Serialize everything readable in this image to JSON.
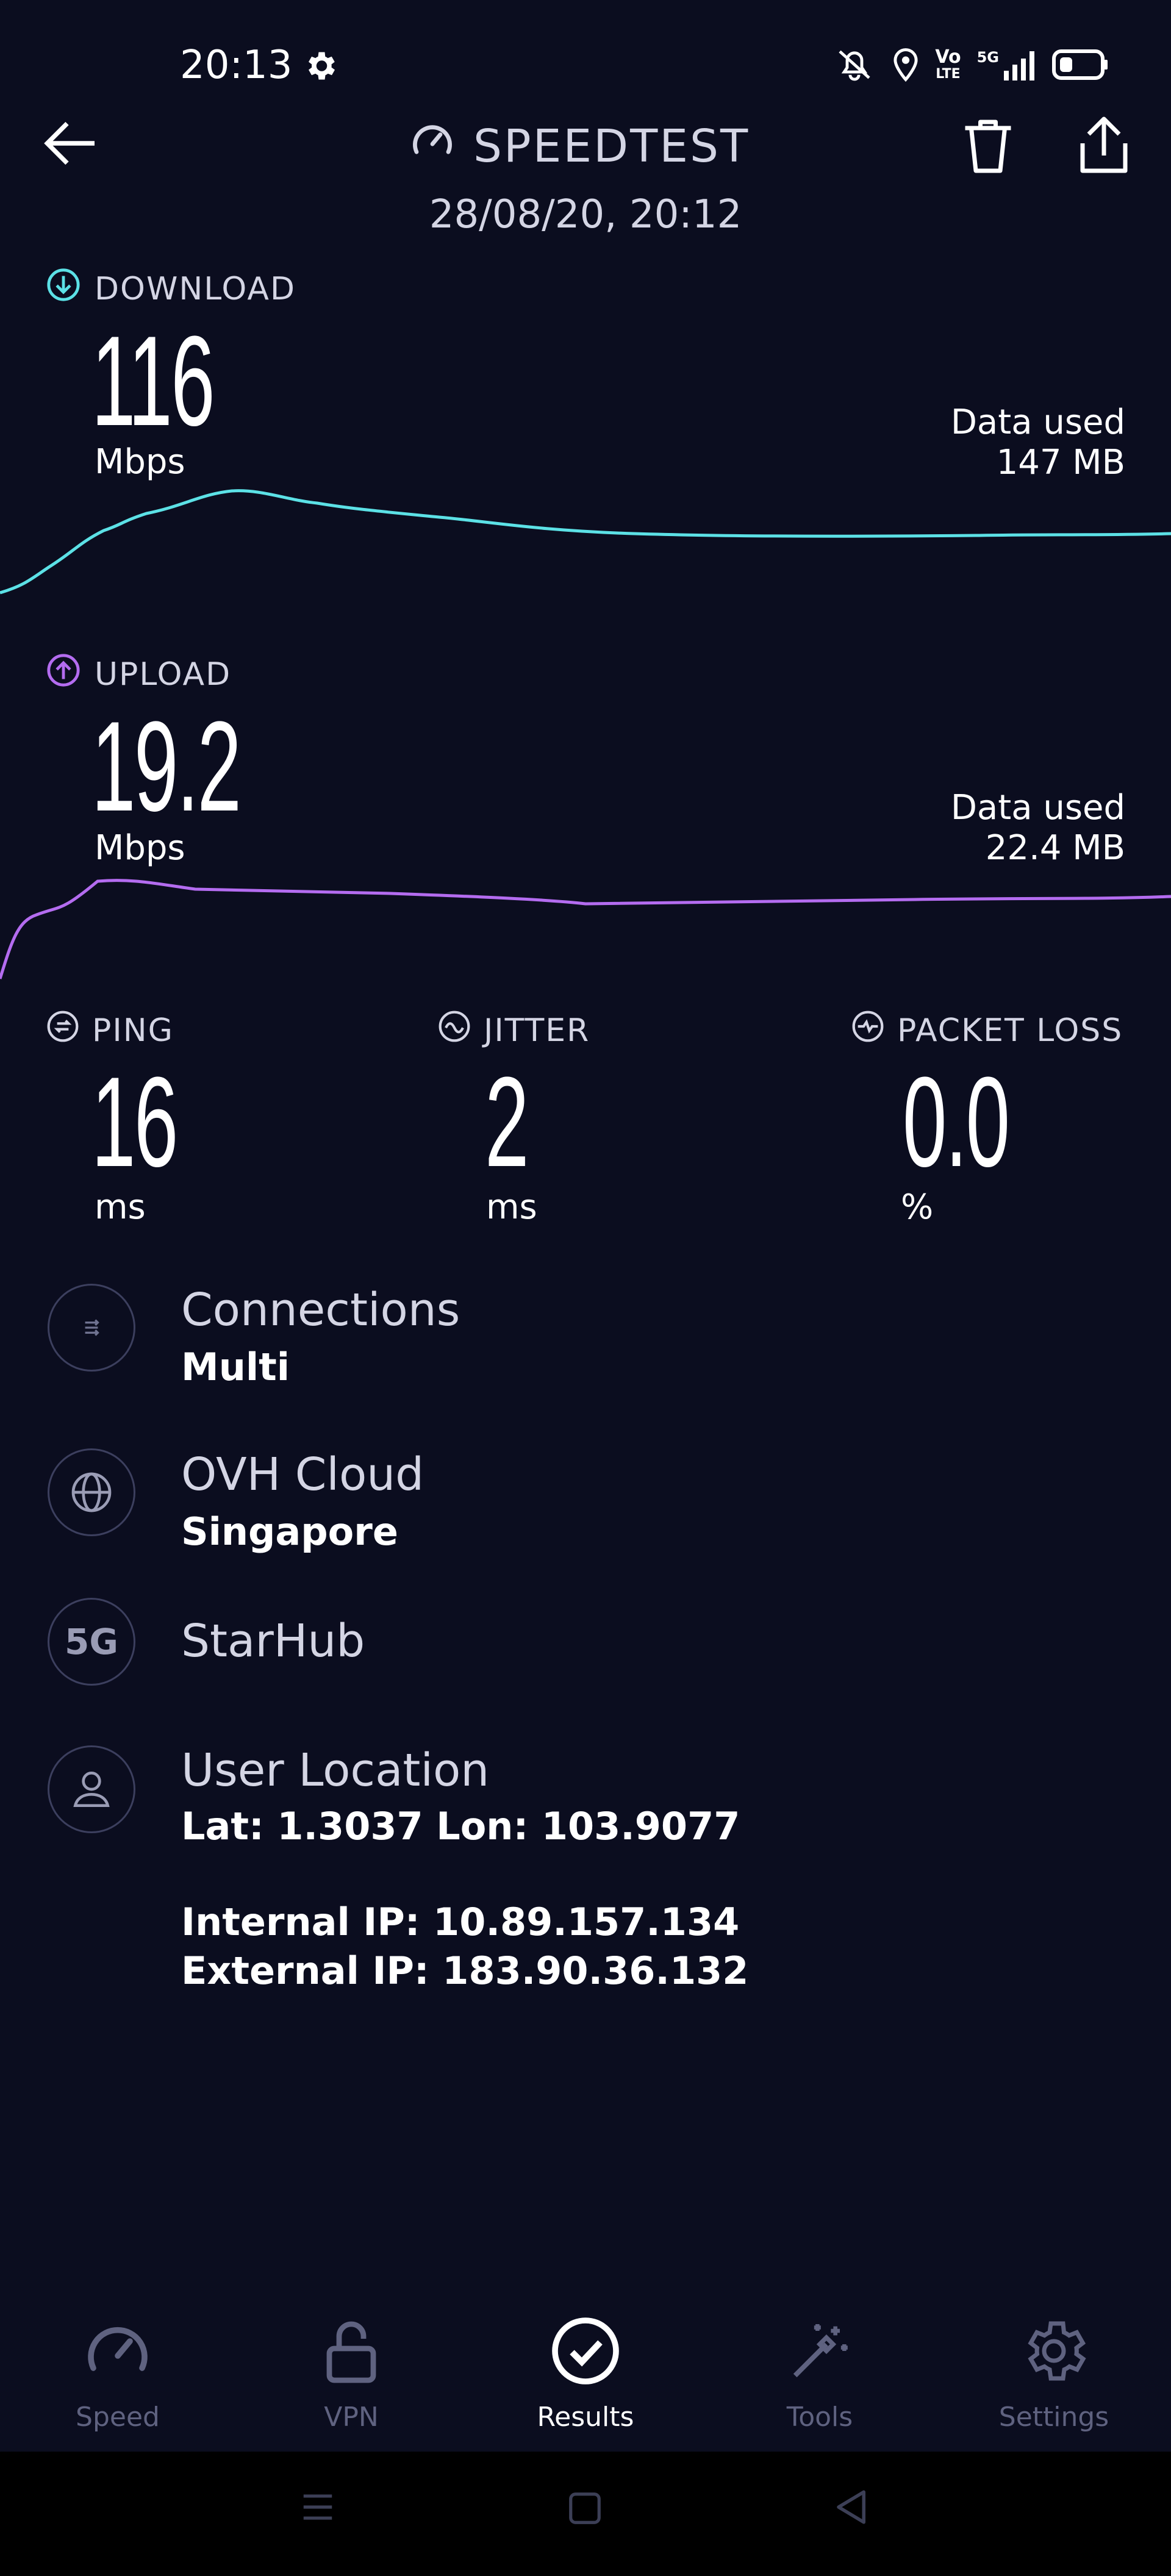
{
  "status_bar": {
    "time": "20:13",
    "icons": [
      "gear-icon",
      "mute-bell-icon",
      "location-icon",
      "volte-icon",
      "5g-signal-icon",
      "battery-icon"
    ],
    "signal_label": "5G",
    "volte_label_top": "Vo",
    "volte_label_bottom": "LTE"
  },
  "header": {
    "title": "SPEEDTEST",
    "date": "28/08/20, 20:12",
    "icons": [
      "back-arrow-icon",
      "speedometer-icon",
      "trash-icon",
      "share-icon"
    ]
  },
  "download": {
    "label": "DOWNLOAD",
    "value": "116",
    "unit": "Mbps",
    "data_used_label": "Data used",
    "data_used_value": "147 MB",
    "color": "#5ce1e6"
  },
  "upload": {
    "label": "UPLOAD",
    "value": "19.2",
    "unit": "Mbps",
    "data_used_label": "Data used",
    "data_used_value": "22.4 MB",
    "color": "#b46cf0"
  },
  "metrics": [
    {
      "label": "PING",
      "value": "16",
      "unit": "ms",
      "icon": "ping-icon"
    },
    {
      "label": "JITTER",
      "value": "2",
      "unit": "ms",
      "icon": "jitter-icon"
    },
    {
      "label": "PACKET LOSS",
      "value": "0.0",
      "unit": "%",
      "icon": "packet-loss-icon"
    }
  ],
  "info": {
    "connections": {
      "title": "Connections",
      "value": "Multi",
      "icon": "connections-icon"
    },
    "server": {
      "title": "OVH Cloud",
      "value": "Singapore",
      "icon": "globe-icon"
    },
    "provider": {
      "title": "StarHub",
      "badge": "5G",
      "icon": "5g-icon"
    },
    "user": {
      "title": "User Location",
      "coords": "Lat: 1.3037 Lon: 103.9077",
      "internal_ip": "Internal IP: 10.89.157.134",
      "external_ip": "External IP: 183.90.36.132",
      "icon": "user-icon"
    }
  },
  "nav": {
    "items": [
      {
        "label": "Speed",
        "icon": "speedometer-icon",
        "active": false
      },
      {
        "label": "VPN",
        "icon": "lock-icon",
        "active": false
      },
      {
        "label": "Results",
        "icon": "check-circle-icon",
        "active": true
      },
      {
        "label": "Tools",
        "icon": "magic-wand-icon",
        "active": false
      },
      {
        "label": "Settings",
        "icon": "gear-icon",
        "active": false
      }
    ]
  },
  "system_nav": {
    "icons": [
      "menu-icon",
      "home-icon",
      "back-icon"
    ]
  },
  "colors": {
    "background": "#0b0d1f",
    "download": "#5ce1e6",
    "upload": "#b46cf0",
    "muted": "#d4d5e4",
    "inactive": "#5f6280"
  }
}
